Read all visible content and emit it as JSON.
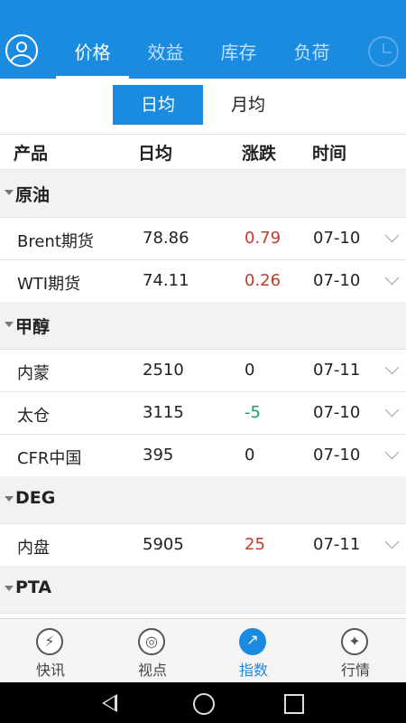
{
  "header": {
    "tabs": [
      "价格",
      "效益",
      "库存",
      "负荷"
    ],
    "active_tab": 0,
    "accent_color": "#1b8be0"
  },
  "period_toggle": {
    "daily": "日均",
    "monthly": "月均",
    "selected": "日均"
  },
  "columns": {
    "product": "产品",
    "daily_avg": "日均",
    "change": "涨跌",
    "time": "时间"
  },
  "groups": [
    {
      "name": "原油",
      "rows": [
        {
          "name": "Brent期货",
          "value": "78.86",
          "change": "0.79",
          "time": "07-10"
        },
        {
          "name": "WTI期货",
          "value": "74.11",
          "change": "0.26",
          "time": "07-10"
        }
      ]
    },
    {
      "name": "甲醇",
      "rows": [
        {
          "name": "内蒙",
          "value": "2510",
          "change": "0",
          "time": "07-11"
        },
        {
          "name": "太仓",
          "value": "3115",
          "change": "-5",
          "time": "07-10"
        },
        {
          "name": "CFR中国",
          "value": "395",
          "change": "0",
          "time": "07-10"
        }
      ]
    },
    {
      "name": "DEG",
      "rows": [
        {
          "name": "内盘",
          "value": "5905",
          "change": "25",
          "time": "07-11"
        }
      ]
    },
    {
      "name": "PTA",
      "rows": []
    }
  ],
  "bottom_nav": [
    {
      "label": "快讯",
      "icon": "lightning-icon"
    },
    {
      "label": "视点",
      "icon": "globe-icon"
    },
    {
      "label": "指数",
      "icon": "trend-icon"
    },
    {
      "label": "行情",
      "icon": "compass-icon"
    }
  ],
  "bottom_nav_active": 2,
  "colors": {
    "up": "#c0392b",
    "down": "#16a06b"
  }
}
